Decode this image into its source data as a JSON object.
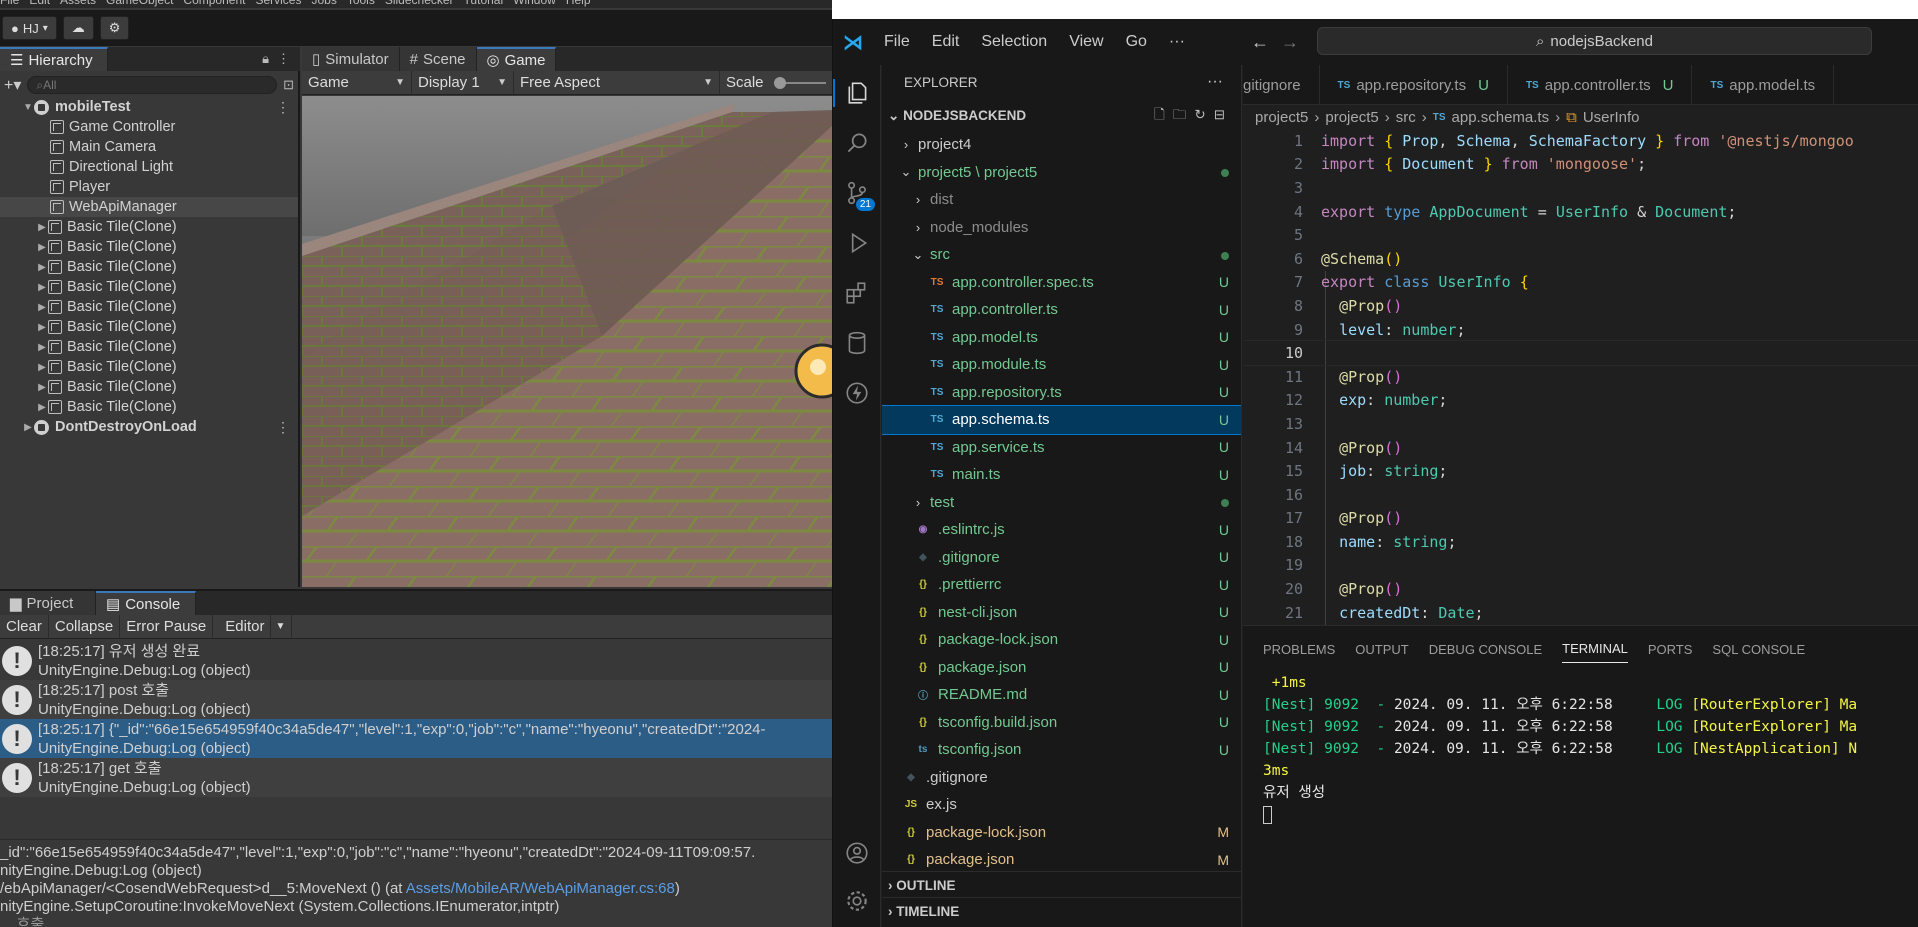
{
  "unity": {
    "menubar": [
      "File",
      "Edit",
      "Assets",
      "GameObject",
      "Component",
      "Services",
      "Jobs",
      "Tools",
      "Slidechecker",
      "Tutorial",
      "Window",
      "Help"
    ],
    "toolbar": {
      "account": "HJ"
    },
    "hierarchy": {
      "tab": "Hierarchy",
      "search_placeholder": "All",
      "items": [
        {
          "label": "mobileTest",
          "kind": "scene"
        },
        {
          "label": "Game Controller",
          "kind": "object"
        },
        {
          "label": "Main Camera",
          "kind": "object"
        },
        {
          "label": "Directional Light",
          "kind": "object"
        },
        {
          "label": "Player",
          "kind": "object"
        },
        {
          "label": "WebApiManager",
          "kind": "object"
        },
        {
          "label": "Basic Tile(Clone)",
          "kind": "prefab"
        },
        {
          "label": "Basic Tile(Clone)",
          "kind": "prefab"
        },
        {
          "label": "Basic Tile(Clone)",
          "kind": "prefab"
        },
        {
          "label": "Basic Tile(Clone)",
          "kind": "prefab"
        },
        {
          "label": "Basic Tile(Clone)",
          "kind": "prefab"
        },
        {
          "label": "Basic Tile(Clone)",
          "kind": "prefab"
        },
        {
          "label": "Basic Tile(Clone)",
          "kind": "prefab"
        },
        {
          "label": "Basic Tile(Clone)",
          "kind": "prefab"
        },
        {
          "label": "Basic Tile(Clone)",
          "kind": "prefab"
        },
        {
          "label": "Basic Tile(Clone)",
          "kind": "prefab"
        },
        {
          "label": "DontDestroyOnLoad",
          "kind": "scene"
        }
      ]
    },
    "game": {
      "tabs": [
        "Simulator",
        "Scene",
        "Game"
      ],
      "active_tab": "Game",
      "toolbar": {
        "mode": "Game",
        "display": "Display 1",
        "aspect": "Free Aspect",
        "scale_label": "Scale"
      }
    },
    "console": {
      "tabs": [
        "Project",
        "Console"
      ],
      "toolbar": [
        "Clear",
        "Collapse",
        "Error Pause",
        "Editor"
      ],
      "logs": [
        {
          "line1": "[18:25:17] 유저 생성 완료",
          "line2": "UnityEngine.Debug:Log (object)"
        },
        {
          "line1": "[18:25:17] post 호출",
          "line2": "UnityEngine.Debug:Log (object)"
        },
        {
          "line1": "[18:25:17] {\"_id\":\"66e15e654959f40c34a5de47\",\"level\":1,\"exp\":0,\"job\":\"c\",\"name\":\"hyeonu\",\"createdDt\":\"2024-",
          "line2": "UnityEngine.Debug:Log (object)"
        },
        {
          "line1": "[18:25:17] get 호출",
          "line2": "UnityEngine.Debug:Log (object)"
        }
      ],
      "detail": {
        "l1": "_id\":\"66e15e654959f40c34a5de47\",\"level\":1,\"exp\":0,\"job\":\"c\",\"name\":\"hyeonu\",\"createdDt\":\"2024-09-11T09:09:57.",
        "l2": "nityEngine.Debug:Log (object)",
        "l3a": "/ebApiManager/<CosendWebRequest>d__5:MoveNext () (at ",
        "l3link": "Assets/MobileAR/WebApiManager.cs:68",
        "l3b": ")",
        "l4": "nityEngine.SetupCoroutine:InvokeMoveNext (System.Collections.IEnumerator,intptr)",
        "l5": "... 호출"
      }
    }
  },
  "vscode": {
    "menu": [
      "File",
      "Edit",
      "Selection",
      "View",
      "Go",
      "···"
    ],
    "command_center": "nodejsBackend",
    "scm_badge": "21",
    "explorer": {
      "title": "EXPLORER",
      "root": "NODEJSBACKEND",
      "outline": "OUTLINE",
      "timeline": "TIMELINE",
      "rows": [
        {
          "label": "project4",
          "depth": 1,
          "chev": "›",
          "icon": "",
          "status": "",
          "color": "#cccccc"
        },
        {
          "label": "project5 \\ project5",
          "depth": 1,
          "chev": "⌄",
          "icon": "",
          "status": "dot",
          "color": "#73c991"
        },
        {
          "label": "dist",
          "depth": 2,
          "chev": "›",
          "icon": "",
          "status": "",
          "color": "#8c8c8c"
        },
        {
          "label": "node_modules",
          "depth": 2,
          "chev": "›",
          "icon": "",
          "status": "",
          "color": "#8c8c8c"
        },
        {
          "label": "src",
          "depth": 2,
          "chev": "⌄",
          "icon": "",
          "status": "dot",
          "color": "#73c991"
        },
        {
          "label": "app.controller.spec.ts",
          "depth": 3,
          "chev": "",
          "icon": "TS",
          "iconColor": "#e37933",
          "status": "U",
          "color": "#73c991"
        },
        {
          "label": "app.controller.ts",
          "depth": 3,
          "chev": "",
          "icon": "TS",
          "iconColor": "#4fa8d6",
          "status": "U",
          "color": "#73c991"
        },
        {
          "label": "app.model.ts",
          "depth": 3,
          "chev": "",
          "icon": "TS",
          "iconColor": "#4fa8d6",
          "status": "U",
          "color": "#73c991"
        },
        {
          "label": "app.module.ts",
          "depth": 3,
          "chev": "",
          "icon": "TS",
          "iconColor": "#4fa8d6",
          "status": "U",
          "color": "#73c991"
        },
        {
          "label": "app.repository.ts",
          "depth": 3,
          "chev": "",
          "icon": "TS",
          "iconColor": "#4fa8d6",
          "status": "U",
          "color": "#73c991"
        },
        {
          "label": "app.schema.ts",
          "depth": 3,
          "chev": "",
          "icon": "TS",
          "iconColor": "#4fa8d6",
          "status": "U",
          "color": "#73c991",
          "selected": true
        },
        {
          "label": "app.service.ts",
          "depth": 3,
          "chev": "",
          "icon": "TS",
          "iconColor": "#4fa8d6",
          "status": "U",
          "color": "#73c991"
        },
        {
          "label": "main.ts",
          "depth": 3,
          "chev": "",
          "icon": "TS",
          "iconColor": "#4fa8d6",
          "status": "U",
          "color": "#73c991"
        },
        {
          "label": "test",
          "depth": 2,
          "chev": "›",
          "icon": "",
          "status": "dot",
          "color": "#73c991"
        },
        {
          "label": ".eslintrc.js",
          "depth": 2,
          "chev": "",
          "icon": "◉",
          "iconColor": "#a074c4",
          "status": "U",
          "color": "#73c991"
        },
        {
          "label": ".gitignore",
          "depth": 2,
          "chev": "",
          "icon": "◆",
          "iconColor": "#41535b",
          "status": "U",
          "color": "#73c991"
        },
        {
          "label": ".prettierrc",
          "depth": 2,
          "chev": "",
          "icon": "{}",
          "iconColor": "#cbcb41",
          "status": "U",
          "color": "#73c991"
        },
        {
          "label": "nest-cli.json",
          "depth": 2,
          "chev": "",
          "icon": "{}",
          "iconColor": "#cbcb41",
          "status": "U",
          "color": "#73c991"
        },
        {
          "label": "package-lock.json",
          "depth": 2,
          "chev": "",
          "icon": "{}",
          "iconColor": "#cbcb41",
          "status": "U",
          "color": "#73c991"
        },
        {
          "label": "package.json",
          "depth": 2,
          "chev": "",
          "icon": "{}",
          "iconColor": "#cbcb41",
          "status": "U",
          "color": "#73c991"
        },
        {
          "label": "README.md",
          "depth": 2,
          "chev": "",
          "icon": "ⓘ",
          "iconColor": "#519aba",
          "status": "U",
          "color": "#73c991"
        },
        {
          "label": "tsconfig.build.json",
          "depth": 2,
          "chev": "",
          "icon": "{}",
          "iconColor": "#cbcb41",
          "status": "U",
          "color": "#73c991"
        },
        {
          "label": "tsconfig.json",
          "depth": 2,
          "chev": "",
          "icon": "ts",
          "iconColor": "#519aba",
          "status": "U",
          "color": "#73c991"
        },
        {
          "label": ".gitignore",
          "depth": 1,
          "chev": "",
          "icon": "◆",
          "iconColor": "#41535b",
          "status": "",
          "color": "#cccccc"
        },
        {
          "label": "ex.js",
          "depth": 1,
          "chev": "",
          "icon": "JS",
          "iconColor": "#cbcb41",
          "status": "",
          "color": "#cccccc"
        },
        {
          "label": "package-lock.json",
          "depth": 1,
          "chev": "",
          "icon": "{}",
          "iconColor": "#cbcb41",
          "status": "M",
          "color": "#e2c08d"
        },
        {
          "label": "package.json",
          "depth": 1,
          "chev": "",
          "icon": "{}",
          "iconColor": "#cbcb41",
          "status": "M",
          "color": "#e2c08d"
        }
      ]
    },
    "editor": {
      "tabs": [
        {
          "label": "gitignore",
          "ts": false,
          "u": false
        },
        {
          "label": "app.repository.ts",
          "ts": true,
          "u": true
        },
        {
          "label": "app.controller.ts",
          "ts": true,
          "u": true
        },
        {
          "label": "app.model.ts",
          "ts": true,
          "u": false
        }
      ],
      "breadcrumb": [
        "project5",
        "project5",
        "src",
        "app.schema.ts",
        "UserInfo"
      ],
      "current_line": 10
    },
    "panel": {
      "tabs": [
        "PROBLEMS",
        "OUTPUT",
        "DEBUG CONSOLE",
        "TERMINAL",
        "PORTS",
        "SQL CONSOLE"
      ],
      "active": "TERMINAL",
      "lines": [
        {
          "a": " +1ms",
          "b": "",
          "c": "",
          "d": ""
        },
        {
          "a": "[Nest] 9092  - ",
          "b": "2024. 09. 11. 오후 6:22:58",
          "c": "     LOG ",
          "d": "[RouterExplorer] Ma"
        },
        {
          "a": "[Nest] 9092  - ",
          "b": "2024. 09. 11. 오후 6:22:58",
          "c": "     LOG ",
          "d": "[RouterExplorer] Ma"
        },
        {
          "a": "[Nest] 9092  - ",
          "b": "2024. 09. 11. 오후 6:22:58",
          "c": "     LOG ",
          "d": "[NestApplication] N"
        },
        {
          "a": "3ms",
          "b": "",
          "c": "",
          "d": ""
        }
      ],
      "output": "유저 생성"
    }
  }
}
